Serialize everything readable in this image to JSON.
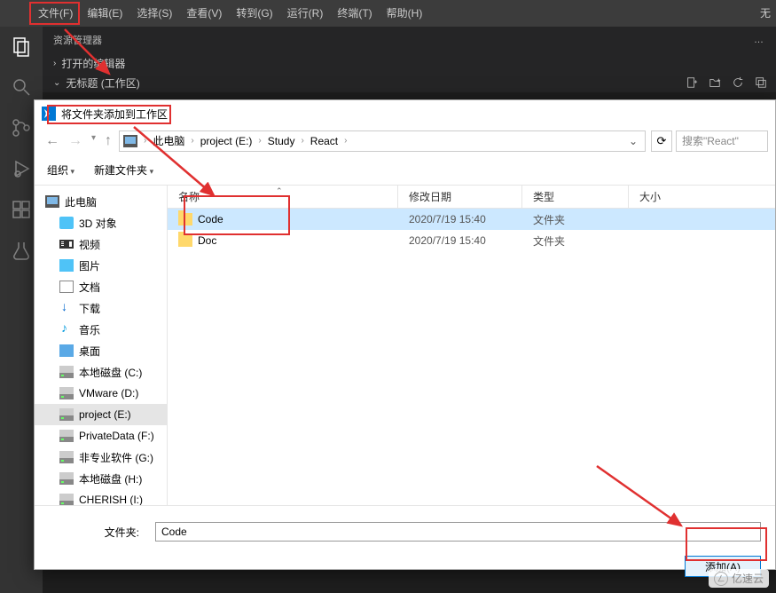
{
  "menubar": {
    "file": "文件(F)",
    "edit": "编辑(E)",
    "select": "选择(S)",
    "view": "查看(V)",
    "goto": "转到(G)",
    "run": "运行(R)",
    "terminal": "终端(T)",
    "help": "帮助(H)"
  },
  "title_right": "无",
  "explorer": {
    "title": "资源管理器",
    "ellipsis": "…",
    "open_editors": "打开的编辑器",
    "workspace": "无标题 (工作区)",
    "icons": {
      "newfile": "new-file-icon",
      "newfolder": "new-folder-icon",
      "refresh": "refresh-icon",
      "collapse": "collapse-icon"
    }
  },
  "dialog": {
    "title": "将文件夹添加到工作区",
    "breadcrumb": {
      "root": "此电脑",
      "path": [
        "project (E:)",
        "Study",
        "React"
      ]
    },
    "nav": {
      "refresh_tip": "刷新"
    },
    "search_placeholder": "搜索\"React\"",
    "toolbar": {
      "org": "组织",
      "newfolder": "新建文件夹"
    },
    "columns": {
      "name": "名称",
      "date": "修改日期",
      "type": "类型",
      "size": "大小"
    },
    "tree": {
      "root": "此电脑",
      "items": [
        {
          "label": "3D 对象",
          "icon": "threed"
        },
        {
          "label": "视频",
          "icon": "video"
        },
        {
          "label": "图片",
          "icon": "img"
        },
        {
          "label": "文档",
          "icon": "doc"
        },
        {
          "label": "下载",
          "icon": "down"
        },
        {
          "label": "音乐",
          "icon": "music"
        },
        {
          "label": "桌面",
          "icon": "desk"
        },
        {
          "label": "本地磁盘 (C:)",
          "icon": "drive"
        },
        {
          "label": "VMware (D:)",
          "icon": "drive"
        },
        {
          "label": "project (E:)",
          "icon": "drive",
          "selected": true
        },
        {
          "label": "PrivateData (F:)",
          "icon": "drive"
        },
        {
          "label": "非专业软件 (G:)",
          "icon": "drive"
        },
        {
          "label": "本地磁盘 (H:)",
          "icon": "drive"
        },
        {
          "label": "CHERISH (I:)",
          "icon": "drive"
        }
      ]
    },
    "files": [
      {
        "name": "Code",
        "date": "2020/7/19 15:40",
        "type": "文件夹",
        "selected": true
      },
      {
        "name": "Doc",
        "date": "2020/7/19 15:40",
        "type": "文件夹",
        "selected": false
      }
    ],
    "footer": {
      "label": "文件夹:",
      "value": "Code",
      "add": "添加(A)"
    }
  },
  "watermark": "亿速云"
}
